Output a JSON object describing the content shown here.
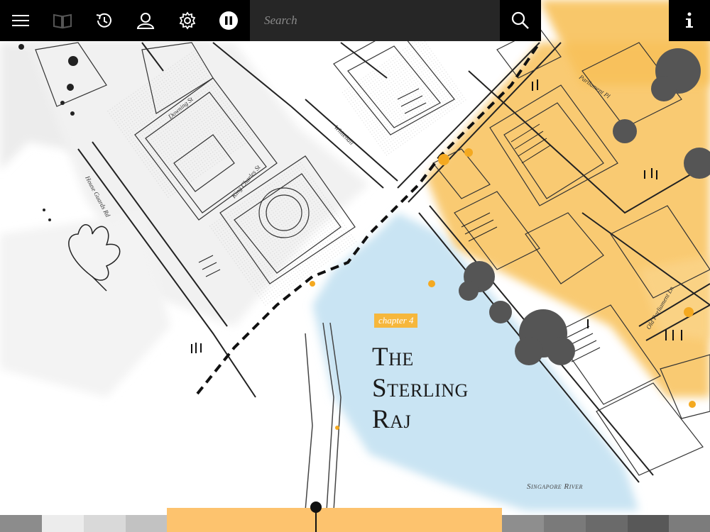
{
  "toolbar": {
    "menu_icon": "hamburger-menu-icon",
    "book_icon": "book-icon",
    "history_icon": "history-clock-icon",
    "profile_icon": "user-profile-icon",
    "settings_icon": "gear-icon",
    "pause_icon": "pause-icon",
    "search_icon": "search-icon",
    "info_icon": "info-icon"
  },
  "search": {
    "placeholder": "Search",
    "value": ""
  },
  "chapter": {
    "tag": "chapter 4",
    "title_line1": "The",
    "title_line2": "Sterling",
    "title_line3": "Raj"
  },
  "map_labels": {
    "downing": "Downing St",
    "whitehall": "Whitehall",
    "king_charles": "King Charles St",
    "horse_guards": "House Guards Rd",
    "parliament_pl": "Parliament Pl",
    "old_parliament": "Old Parliament Ln",
    "river": "Singapore River"
  },
  "timeline": {
    "progress": 0.45
  },
  "colors": {
    "toolbar_bg": "#000000",
    "search_bg": "#262626",
    "accent": "#f6b73c",
    "timeline_active": "#fdc36e",
    "river": "#c9e4f3"
  }
}
